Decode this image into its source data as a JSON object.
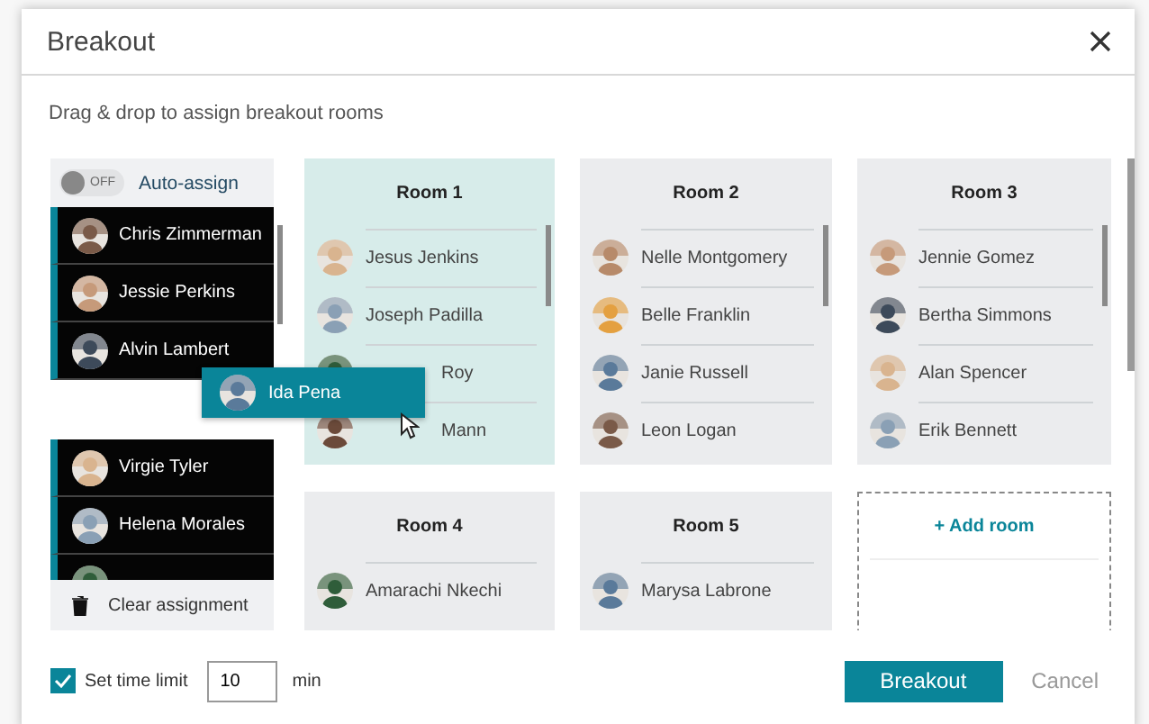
{
  "dialog": {
    "title": "Breakout"
  },
  "instruction": "Drag & drop to assign breakout rooms",
  "auto_assign": {
    "toggle_text": "OFF",
    "on": false,
    "label": "Auto-assign"
  },
  "unassigned_groups": [
    {
      "names": [
        "Chris Zimmerman",
        "Jessie Perkins",
        "Alvin Lambert"
      ]
    },
    {
      "names": [
        "Virgie Tyler",
        "Helena Morales"
      ]
    }
  ],
  "dragging": {
    "name": "Ida Pena"
  },
  "clear_label": "Clear assignment",
  "rooms": [
    {
      "name": "Room 1",
      "highlighted": true,
      "members": [
        "Jesus Jenkins",
        "Joseph Padilla",
        {
          "name": "Roy",
          "covered": true
        },
        {
          "name": "Mann",
          "covered": true
        }
      ]
    },
    {
      "name": "Room 2",
      "highlighted": false,
      "members": [
        "Nelle Montgomery",
        "Belle Franklin",
        "Janie Russell",
        "Leon Logan"
      ]
    },
    {
      "name": "Room 3",
      "highlighted": false,
      "members": [
        "Jennie Gomez",
        "Bertha Simmons",
        "Alan Spencer",
        "Erik Bennett"
      ]
    },
    {
      "name": "Room 4",
      "highlighted": false,
      "members": [
        "Amarachi Nkechi"
      ]
    },
    {
      "name": "Room 5",
      "highlighted": false,
      "members": [
        "Marysa Labrone"
      ]
    }
  ],
  "add_room": "+ Add room",
  "time_limit": {
    "checked": true,
    "label": "Set time limit",
    "value": "10",
    "unit": "min"
  },
  "buttons": {
    "primary": "Breakout",
    "cancel": "Cancel"
  }
}
